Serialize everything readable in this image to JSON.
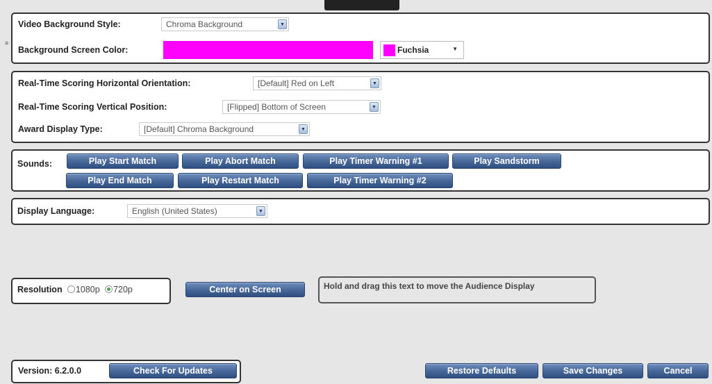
{
  "video_panel": {
    "bg_style_label": "Video Background Style:",
    "bg_style_value": "Chroma Background",
    "screen_color_label": "Background Screen Color:",
    "screen_color_hex": "#ff00ff",
    "screen_color_name": "Fuchsia"
  },
  "scoring_panel": {
    "horizontal_label": "Real-Time Scoring Horizontal Orientation:",
    "horizontal_value": "[Default] Red on Left",
    "vertical_label": "Real-Time Scoring Vertical Position:",
    "vertical_value": "[Flipped] Bottom of Screen",
    "award_label": "Award Display Type:",
    "award_value": "[Default] Chroma Background"
  },
  "sounds_panel": {
    "label": "Sounds:",
    "buttons": [
      "Play Start Match",
      "Play Abort Match",
      "Play Timer Warning #1",
      "Play Sandstorm",
      "Play End Match",
      "Play Restart Match",
      "Play Timer Warning #2"
    ]
  },
  "language_panel": {
    "label": "Display Language:",
    "value": "English (United States)"
  },
  "resolution_panel": {
    "label": "Resolution",
    "option_1080": "1080p",
    "option_720": "720p",
    "selected": "720p"
  },
  "center_button": "Center on Screen",
  "drag_hint": "Hold and drag this text to move the Audience Display",
  "version_panel": {
    "version_text": "Version: 6.2.0.0",
    "check_updates": "Check For Updates"
  },
  "footer": {
    "restore_defaults": "Restore Defaults",
    "save_changes": "Save Changes",
    "cancel": "Cancel"
  },
  "colors": {
    "button_blue": "#48699a",
    "panel_border": "#333333",
    "page_bg": "#e6e6e6"
  }
}
